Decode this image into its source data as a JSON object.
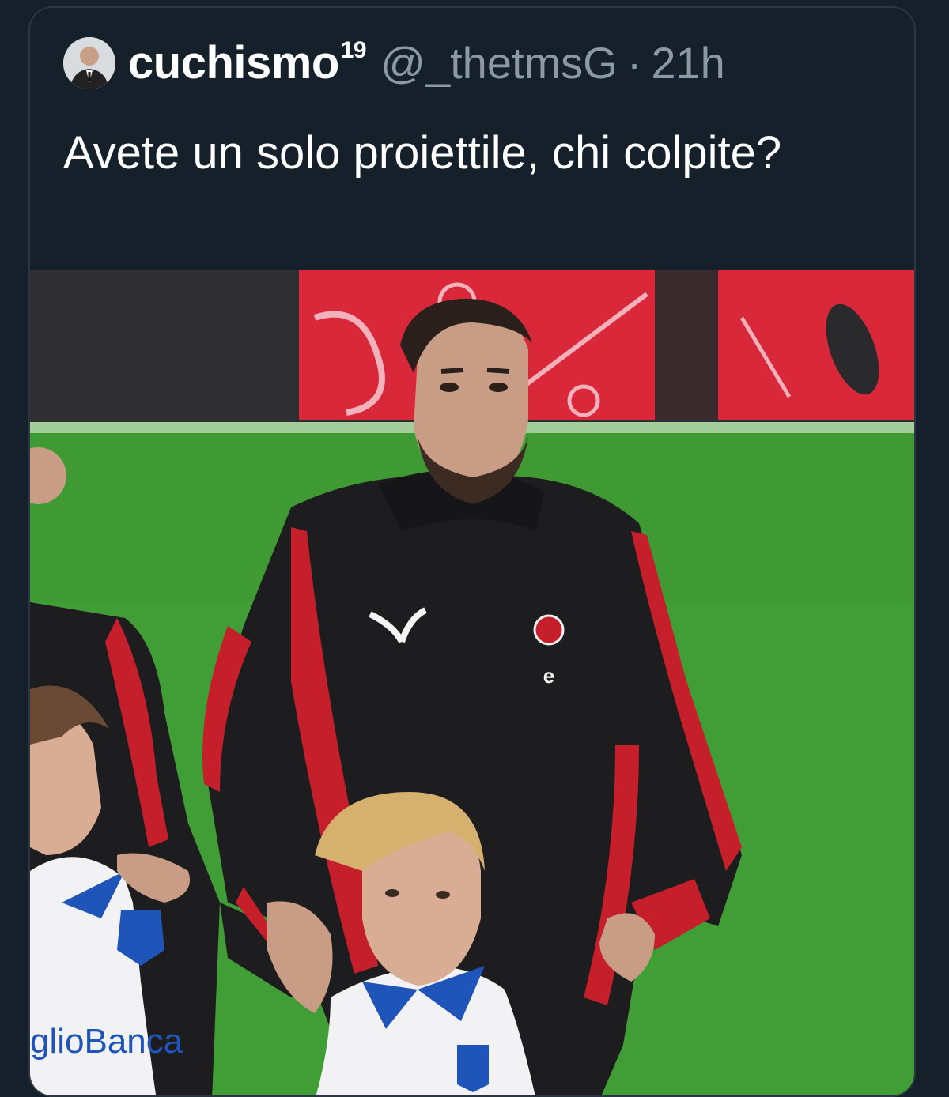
{
  "tweet": {
    "display_name": "cuchismo",
    "display_name_sup": "19",
    "handle": "@_thetmsG",
    "separator": "·",
    "time": "21h",
    "text": "Avete un solo proiettile, chi colpite?"
  },
  "photo": {
    "sponsor_text": "glioBanca",
    "colors": {
      "pitch": "#3f9a33",
      "led_board": "#d8283a",
      "jacket": "#1d1d1f",
      "jacket_stripe": "#c41f2a",
      "kit": "#f2f2f4",
      "kit_collar": "#1f55b8"
    }
  }
}
